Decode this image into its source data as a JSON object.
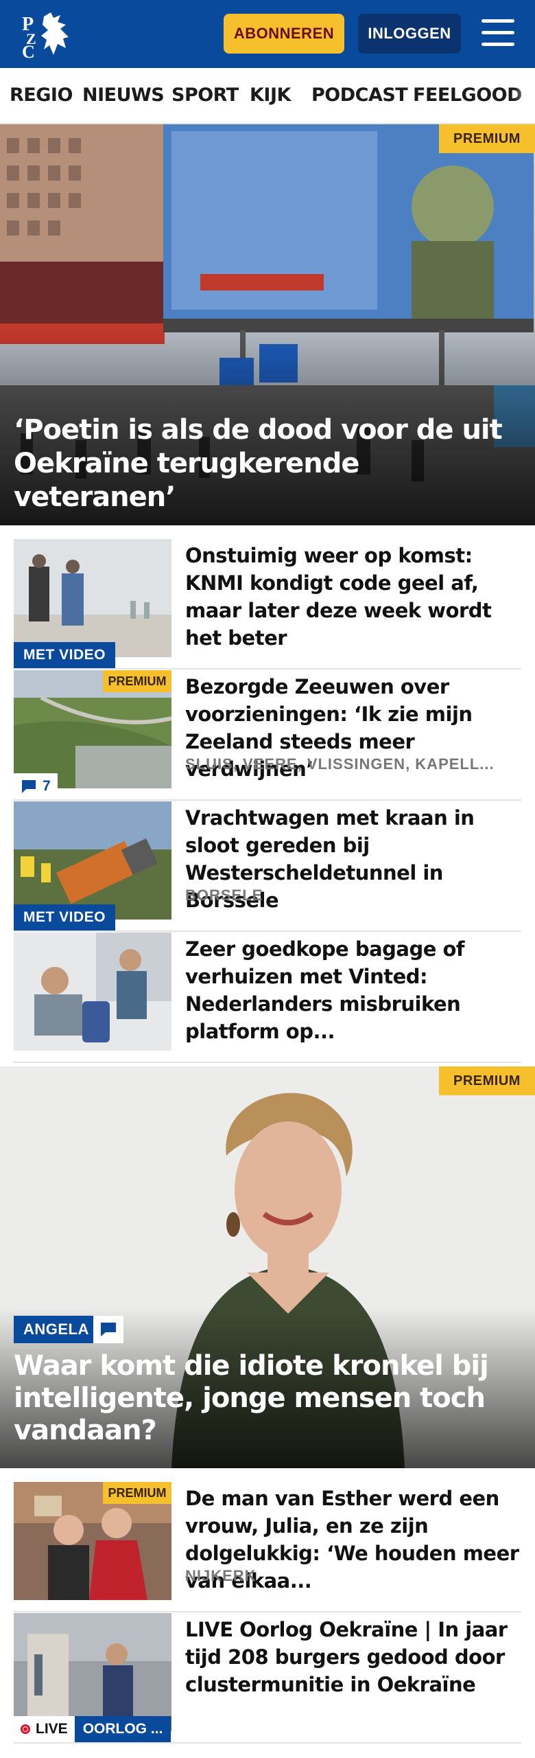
{
  "header": {
    "logo_text": "PZC",
    "subscribe_label": "ABONNEREN",
    "login_label": "INLOGGEN"
  },
  "nav": {
    "items": [
      "REGIO",
      "NIEUWS",
      "SPORT",
      "KIJK",
      "PODCAST",
      "FEELGOOD"
    ]
  },
  "hero": {
    "badge": "PREMIUM",
    "title": "‘Poetin is als de dood voor de uit Oekraïne terugkerende veteranen’"
  },
  "articles": [
    {
      "title": "Onstuimig weer op komst: KNMI kondigt code geel af, maar later deze week wordt het beter",
      "tag": "MET VIDEO"
    },
    {
      "title": "Bezorgde Zeeuwen over voorzieningen: ‘Ik zie mijn Zeeland steeds meer verdwijnen’",
      "location": "SLUIS, VEERE, VLISSINGEN, KAPELL...",
      "badge": "PREMIUM",
      "comments": "7"
    },
    {
      "title": "Vrachtwagen met kraan in sloot gereden bij Westerscheldetunnel in Borssele",
      "location": "BORSELE",
      "tag": "MET VIDEO"
    },
    {
      "title": "Zeer goedkope bagage of verhuizen met Vinted: Nederlan­ders misbruiken platform op..."
    }
  ],
  "feature": {
    "badge": "PREMIUM",
    "tag": "ANGELA",
    "title": "Waar komt die idiote kronkel bij intelligente, jonge mensen toch vandaan?"
  },
  "articles2": [
    {
      "title": "De man van Esther werd een vrouw, Julia, en ze zijn dolgeluk­kig: ‘We houden meer van elkaa...",
      "location": "NIJKERK",
      "badge": "PREMIUM"
    },
    {
      "title": "LIVE Oorlog Oekraïne | In jaar tijd 208 burgers gedood door clustermunitie in Oekraïne",
      "live_label": "LIVE",
      "section_label": "OORLOG ..."
    }
  ],
  "colors": {
    "brand_blue": "#0a4a9c",
    "accent_yellow": "#f5c02c",
    "live_red": "#e0102b"
  }
}
